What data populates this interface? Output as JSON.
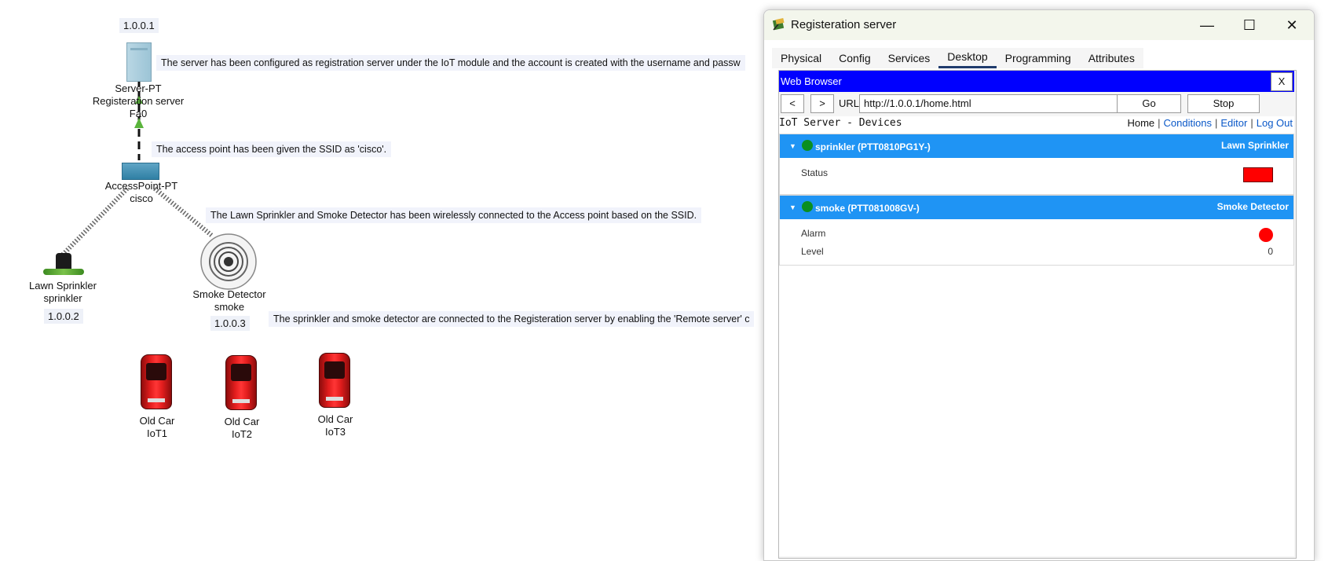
{
  "canvas": {
    "server": {
      "ip": "1.0.0.1",
      "type": "Server-PT",
      "name": "Registeration server",
      "port": "Fa0"
    },
    "access_point": {
      "type": "AccessPoint-PT",
      "name": "cisco"
    },
    "sprinkler": {
      "type": "Lawn Sprinkler",
      "name": "sprinkler",
      "ip": "1.0.0.2"
    },
    "smoke": {
      "type": "Smoke Detector",
      "name": "smoke",
      "ip": "1.0.0.3"
    },
    "cars": [
      {
        "type": "Old Car",
        "name": "IoT1"
      },
      {
        "type": "Old Car",
        "name": "IoT2"
      },
      {
        "type": "Old Car",
        "name": "IoT3"
      }
    ],
    "notes": [
      "The server has been configured as registration server under the IoT module and the account is created with the username and passw",
      "The access point has been given the SSID as 'cisco'.",
      "The Lawn Sprinkler and Smoke Detector has been wirelessly connected to the Access point based on the SSID.",
      "The sprinkler and smoke detector are connected to the Registeration server by enabling the 'Remote server' c"
    ]
  },
  "window": {
    "title": "Registeration server",
    "controls": {
      "minimize": "—",
      "maximize": "☐",
      "close": "✕"
    },
    "tabs": [
      "Physical",
      "Config",
      "Services",
      "Desktop",
      "Programming",
      "Attributes"
    ],
    "active_tab": "Desktop"
  },
  "browser": {
    "title": "Web Browser",
    "close_label": "X",
    "back_label": "<",
    "forward_label": ">",
    "url_label": "URL",
    "url": "http://1.0.0.1/home.html",
    "go_label": "Go",
    "stop_label": "Stop"
  },
  "iot_page": {
    "title": "IoT Server - Devices",
    "nav": {
      "home": "Home",
      "conditions": "Conditions",
      "editor": "Editor",
      "logout": "Log Out",
      "separator": "|"
    },
    "devices": [
      {
        "name": "sprinkler (PTT0810PG1Y-)",
        "type": "Lawn Sprinkler",
        "status_color": "#0a8f1f",
        "rows": [
          {
            "label": "Status",
            "indicator": "red-rectangle",
            "indicator_color": "#ff0000"
          }
        ]
      },
      {
        "name": "smoke (PTT081008GV-)",
        "type": "Smoke Detector",
        "status_color": "#0a8f1f",
        "rows": [
          {
            "label": "Alarm",
            "indicator": "red-circle",
            "indicator_color": "#ff0000"
          },
          {
            "label": "Level",
            "value": "0"
          }
        ]
      }
    ]
  },
  "colors": {
    "browser_bar": "#0000ff",
    "device_header": "#1f94f4",
    "link": "#0a58c8",
    "wire_green": "#5ab43c"
  }
}
